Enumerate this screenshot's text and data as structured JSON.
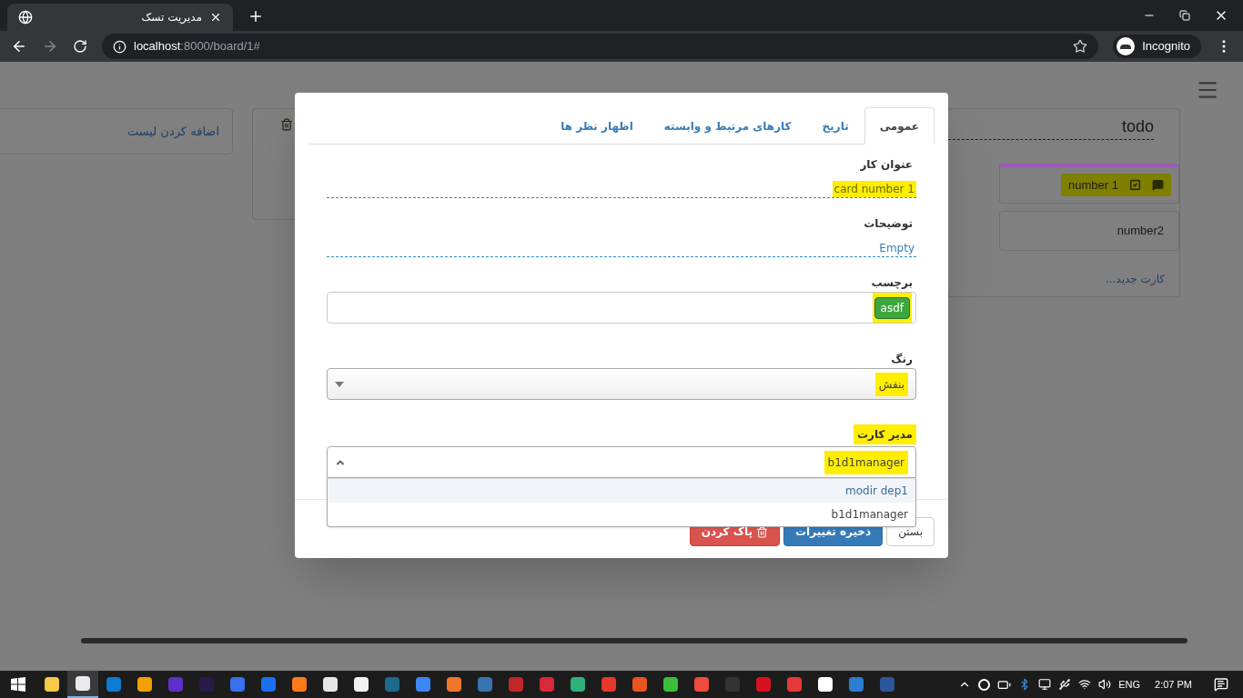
{
  "browser": {
    "tab_title": "مدیریت تسک",
    "url_host": "localhost",
    "url_path": ":8000/board/1#",
    "profile": "Incognito"
  },
  "board": {
    "add_list": "اضافه کردن لیست",
    "list": {
      "title": "todo",
      "new_card": "کارت جدید...",
      "cards": [
        {
          "title": "number 1",
          "color": "#9b59b6",
          "highlighted": true,
          "has_checklist": true,
          "has_comments": true
        },
        {
          "title": "number2",
          "highlighted": false,
          "has_checklist": false,
          "has_comments": false
        }
      ]
    }
  },
  "modal": {
    "tabs": [
      {
        "label": "عمومی",
        "selected": true
      },
      {
        "label": "تاریخ",
        "selected": false
      },
      {
        "label": "کارهای مرتبط و وابسته",
        "selected": false
      },
      {
        "label": "اظهار نظر ها",
        "selected": false
      }
    ],
    "fields": [
      {
        "kind": "inline",
        "label": "عنوان کار",
        "label_highlighted": false,
        "value": "card number 1",
        "highlighted": true
      },
      {
        "kind": "inline",
        "label": "توضیحات",
        "label_highlighted": false,
        "value": "Empty",
        "highlighted": false
      },
      {
        "kind": "tags",
        "label": "برچسب",
        "label_highlighted": false,
        "tags": [
          "asdf"
        ],
        "highlighted": true
      },
      {
        "kind": "select",
        "label": "رنگ",
        "label_highlighted": false,
        "value": "بنفش",
        "highlighted": true,
        "open": false
      },
      {
        "kind": "select",
        "label": "مدیر کارت",
        "label_highlighted": true,
        "value": "b1d1manager",
        "highlighted": true,
        "open": true,
        "options": [
          {
            "label": "modir dep1",
            "hovered": true
          },
          {
            "label": "b1d1manager",
            "hovered": false
          }
        ]
      }
    ],
    "buttons": [
      {
        "label": "بستن",
        "kind": "default"
      },
      {
        "label": "ذخیره تغییرات",
        "kind": "primary"
      },
      {
        "label": "پاک کردن",
        "kind": "danger"
      }
    ]
  },
  "taskbar": {
    "language": "ENG",
    "time": "2:07 PM"
  }
}
